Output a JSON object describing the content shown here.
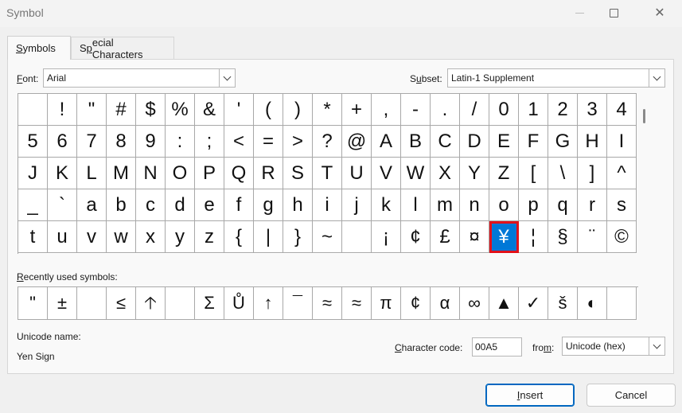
{
  "window": {
    "title": "Symbol"
  },
  "tabs": [
    {
      "prefix": "",
      "accel": "S",
      "rest": "ymbols"
    },
    {
      "prefix": "S",
      "accel": "p",
      "rest": "ecial Characters"
    }
  ],
  "font": {
    "label_accel": "F",
    "label_rest": "ont:",
    "value": "Arial"
  },
  "subset": {
    "label_prefix": "S",
    "label_accel": "u",
    "label_rest": "bset:",
    "value": "Latin-1 Supplement"
  },
  "symbols": [
    " ",
    "!",
    "\"",
    "#",
    "$",
    "%",
    "&",
    "'",
    "(",
    ")",
    "*",
    "+",
    ",",
    "-",
    ".",
    "/",
    "0",
    "1",
    "2",
    "3",
    "4",
    "5",
    "6",
    "7",
    "8",
    "9",
    ":",
    ";",
    "<",
    "=",
    ">",
    "?",
    "@",
    "A",
    "B",
    "C",
    "D",
    "E",
    "F",
    "G",
    "H",
    "I",
    "J",
    "K",
    "L",
    "M",
    "N",
    "O",
    "P",
    "Q",
    "R",
    "S",
    "T",
    "U",
    "V",
    "W",
    "X",
    "Y",
    "Z",
    "[",
    "\\",
    "]",
    "^",
    "_",
    "`",
    "a",
    "b",
    "c",
    "d",
    "e",
    "f",
    "g",
    "h",
    "i",
    "j",
    "k",
    "l",
    "m",
    "n",
    "o",
    "p",
    "q",
    "r",
    "s",
    "t",
    "u",
    "v",
    "w",
    "x",
    "y",
    "z",
    "{",
    "|",
    "}",
    "~",
    " ",
    "¡",
    "¢",
    "£",
    "¤",
    "¥",
    "¦",
    "§",
    "¨",
    "©"
  ],
  "selected_index": 100,
  "recent": {
    "label_accel": "R",
    "label_rest": "ecently used symbols:",
    "symbols": [
      "\"",
      "±",
      " ",
      "≤",
      "🡡",
      " ",
      "Σ",
      "Ů",
      "↑",
      "¯",
      "≈",
      "≈",
      "π",
      "¢",
      "α",
      "∞",
      "▲",
      "✓",
      "š",
      "◐",
      " "
    ]
  },
  "unicode_name": {
    "label": "Unicode name:",
    "value": "Yen Sign"
  },
  "char_code": {
    "label_accel": "C",
    "label_rest": "haracter code:",
    "value": "00A5"
  },
  "from": {
    "label_prefix": "fro",
    "label_accel": "m",
    "label_rest": ":",
    "value": "Unicode (hex)"
  },
  "buttons": {
    "insert_accel": "I",
    "insert_rest": "nsert",
    "cancel": "Cancel"
  },
  "colors": {
    "selection": "#0078d7",
    "highlight_border": "#e1121a",
    "default_button_border": "#0067c0"
  }
}
